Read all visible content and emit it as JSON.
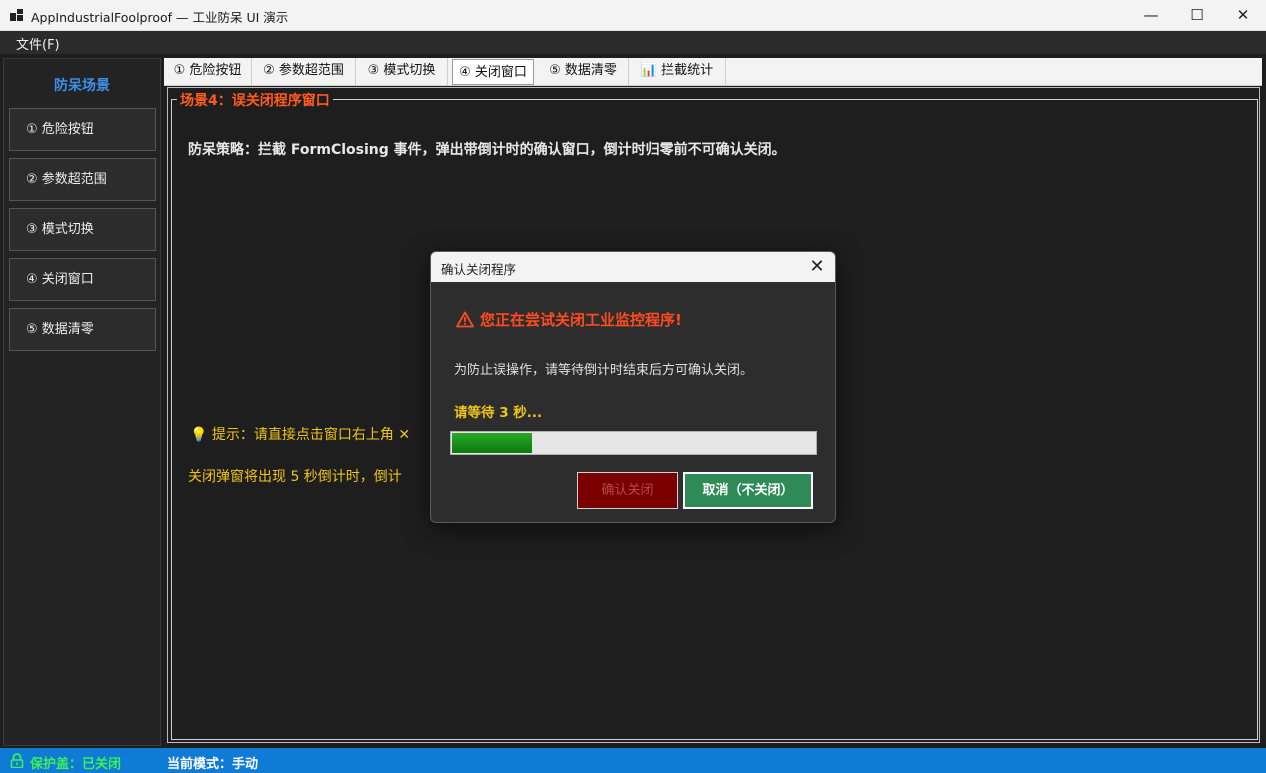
{
  "window": {
    "title": "AppIndustrialFoolproof — 工业防呆 UI 演示",
    "minimize": "—",
    "maximize": "☐",
    "close": "✕"
  },
  "menu": {
    "file": "文件(F)"
  },
  "sidebar": {
    "title": "防呆场景",
    "items": [
      {
        "label": "① 危险按钮"
      },
      {
        "label": "② 参数超范围"
      },
      {
        "label": "③ 模式切换"
      },
      {
        "label": "④ 关闭窗口"
      },
      {
        "label": "⑤ 数据清零"
      }
    ]
  },
  "tabs": [
    {
      "label": "① 危险按钮"
    },
    {
      "label": "② 参数超范围"
    },
    {
      "label": "③ 模式切换"
    },
    {
      "label": "④ 关闭窗口",
      "active": true
    },
    {
      "label": "⑤ 数据清零"
    },
    {
      "label": "📊 拦截统计"
    }
  ],
  "scene": {
    "legend": "场景4：误关闭程序窗口",
    "strategy": "防呆策略：拦截 FormClosing 事件，弹出带倒计时的确认窗口，倒计时归零前不可确认关闭。",
    "hint1": "💡 提示：请直接点击窗口右上角 ✕",
    "hint2": "关闭弹窗将出现 5 秒倒计时，倒计"
  },
  "dialog": {
    "title": "确认关闭程序",
    "close": "✕",
    "warning": "您正在尝试关闭工业监控程序!",
    "message": "为防止误操作，请等待倒计时结束后方可确认关闭。",
    "countdown": "请等待 3 秒...",
    "progress": 0.22,
    "confirm_label": "确认关闭",
    "cancel_label": "取消（不关闭）"
  },
  "status": {
    "guard": "保护盖：已关闭",
    "mode": "当前模式：手动"
  },
  "colors": {
    "accent_blue": "#3d8ee6",
    "legend_orange": "#ff5a1f",
    "hint_yellow": "#f0c419",
    "status_green": "#3df05a",
    "statusbar_blue": "#0f7bd4",
    "confirm_red": "#7a0000",
    "cancel_green": "#2e8b57"
  }
}
